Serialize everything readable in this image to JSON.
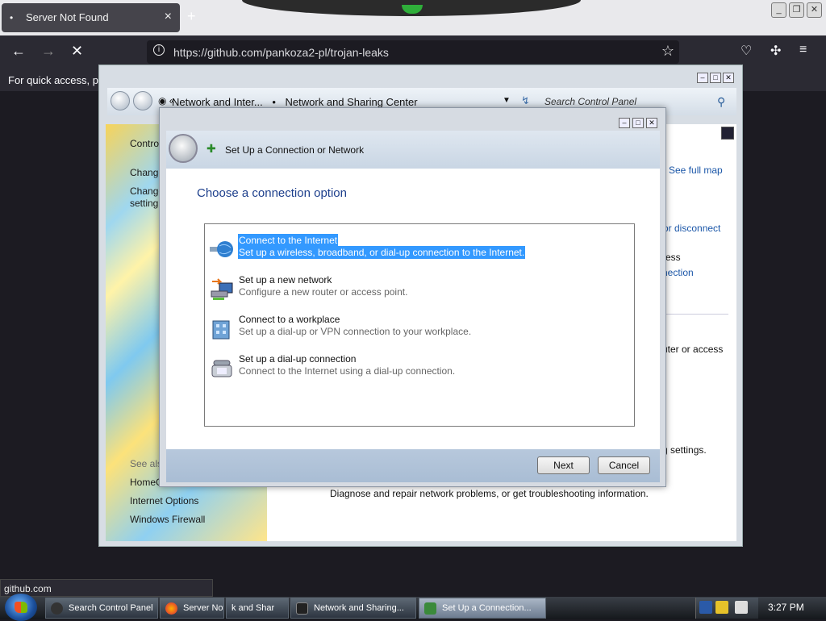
{
  "browser": {
    "tab_title": "Server Not Found",
    "url": "https://github.com/pankoza2-pl/trojan-leaks",
    "bookmarks_hint": "For quick access, plac",
    "status_url": "github.com"
  },
  "control_panel": {
    "breadcrumb_1": "Network and Inter...",
    "breadcrumb_2": "Network and Sharing Center",
    "search_placeholder": "Search Control Panel",
    "sidebar": {
      "control": "Contro",
      "change1": "Change",
      "change2a": "Change",
      "change2b": "setting",
      "see_also": "See als",
      "homegroup": "HomeG",
      "internet_options": "Internet Options",
      "windows_firewall": "Windows Firewall"
    },
    "main": {
      "see_full_map": "See full map",
      "or_disconnect": "or disconnect",
      "frag_ess": "ess",
      "frag_nection": "nection",
      "frag_router": "uter or access",
      "frag_settings": "g settings.",
      "diagnose": "Diagnose and repair network problems, or get troubleshooting information."
    }
  },
  "dialog": {
    "title": "Set Up a Connection or Network",
    "heading": "Choose a connection option",
    "options": [
      {
        "title": "Connect to the Internet",
        "desc": "Set up a wireless, broadband, or dial-up connection to the Internet.",
        "icon": "globe-icon",
        "selected": true
      },
      {
        "title": "Set up a new network",
        "desc": "Configure a new router or access point.",
        "icon": "network-router-icon",
        "selected": false
      },
      {
        "title": "Connect to a workplace",
        "desc": "Set up a dial-up or VPN connection to your workplace.",
        "icon": "workplace-building-icon",
        "selected": false
      },
      {
        "title": "Set up a dial-up connection",
        "desc": "Connect to the Internet using a dial-up connection.",
        "icon": "telephone-icon",
        "selected": false
      }
    ],
    "next_label": "Next",
    "cancel_label": "Cancel"
  },
  "taskbar": {
    "items": [
      {
        "label": "Search Control Panel"
      },
      {
        "label": "Server Not F"
      },
      {
        "label": "k and Shar"
      },
      {
        "label": "Network and Sharing..."
      },
      {
        "label": "Set Up a Connection..."
      }
    ],
    "clock": "3:27 PM"
  },
  "colors": {
    "selection": "#3399ff",
    "heading": "#1d3f8c",
    "link": "#1a56a8"
  }
}
